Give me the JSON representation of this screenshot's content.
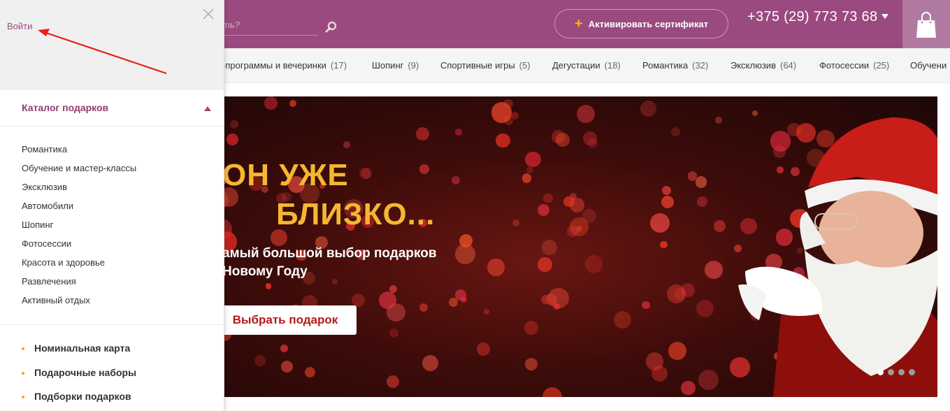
{
  "header": {
    "search_placeholder": "ть?",
    "certificate_label": "Активировать сертификат",
    "phone": "+375 (29) 773 73 68"
  },
  "catnav": {
    "items": [
      {
        "label": "-программы и вечеринки",
        "count": "(17)"
      },
      {
        "label": "Шопинг",
        "count": "(9)"
      },
      {
        "label": "Спортивные игры",
        "count": "(5)"
      },
      {
        "label": "Дегустации",
        "count": "(18)"
      },
      {
        "label": "Романтика",
        "count": "(32)"
      },
      {
        "label": "Эксклюзив",
        "count": "(64)"
      },
      {
        "label": "Фотосессии",
        "count": "(25)"
      },
      {
        "label": "Обучени",
        "count": ""
      }
    ]
  },
  "banner": {
    "headline_1": "ОН УЖЕ",
    "headline_2": "БЛИЗКО...",
    "sub_1": "амый большой выбор подарков",
    "sub_2": "Новому Году",
    "cta": "Выбрать подарок",
    "slides_total": 4,
    "active_slide": 1
  },
  "drawer": {
    "login": "Войти",
    "catalog_title": "Каталог подарков",
    "catalog_items": [
      "Романтика",
      "Обучение и мастер-классы",
      "Эксклюзив",
      "Автомобили",
      "Шопинг",
      "Фотосессии",
      "Красота и здоровье",
      "Развлечения",
      "Активный отдых"
    ],
    "featured": [
      "Номинальная карта",
      "Подарочные наборы",
      "Подборки подарков"
    ]
  },
  "colors": {
    "brand": "#9a4a7e",
    "accent": "#f5b731",
    "annotation": "#e8201c"
  }
}
